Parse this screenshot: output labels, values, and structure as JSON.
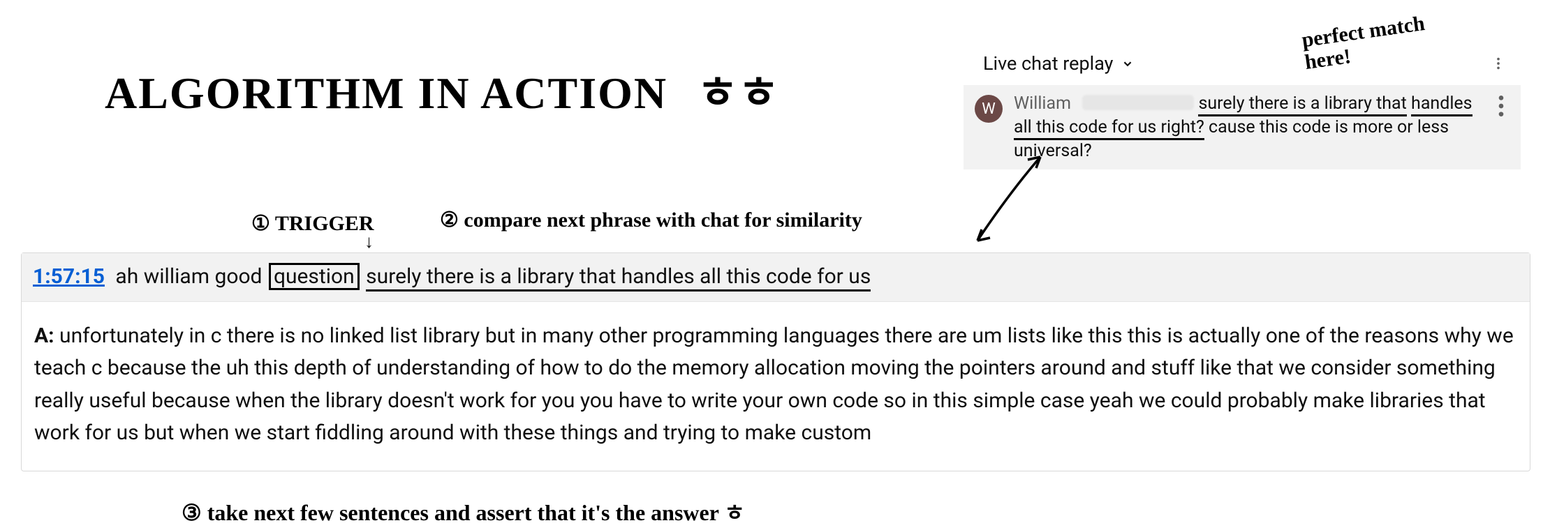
{
  "hand_title": "ALGORITHM IN ACTION",
  "hand_title_smile": "ㅎㅎ",
  "annotations": {
    "trigger": "① TRIGGER",
    "trigger_arrow": "↓",
    "compare": "② compare next phrase with chat for similarity",
    "bottom": "③ take next few sentences and assert that it's the answer ㅎ",
    "match": "perfect match\nhere!"
  },
  "chat": {
    "header_label": "Live chat replay",
    "message": {
      "avatar_initial": "W",
      "author": "William",
      "text_underlined_a": "surely there is a library that",
      "text_underlined_b": "handles all this code for us right?",
      "text_tail": " cause this code is more or less universal?"
    }
  },
  "qa": {
    "timestamp": "1:57:15",
    "pre_text": " ah william good",
    "boxed_word": "question",
    "phrase": "surely there is a library that handles all this code for us",
    "answer_label": "A:",
    "answer_body": " unfortunately in c there is no linked list library but in many other programming languages there are um lists like this this is actually one of the reasons why we teach c because the uh this depth of understanding of how to do the memory allocation moving the pointers around and stuff like that we consider something really useful because when the library doesn't work for you you have to write your own code so in this simple case yeah we could probably make libraries that work for us but when we start fiddling around with these things and trying to make custom"
  }
}
